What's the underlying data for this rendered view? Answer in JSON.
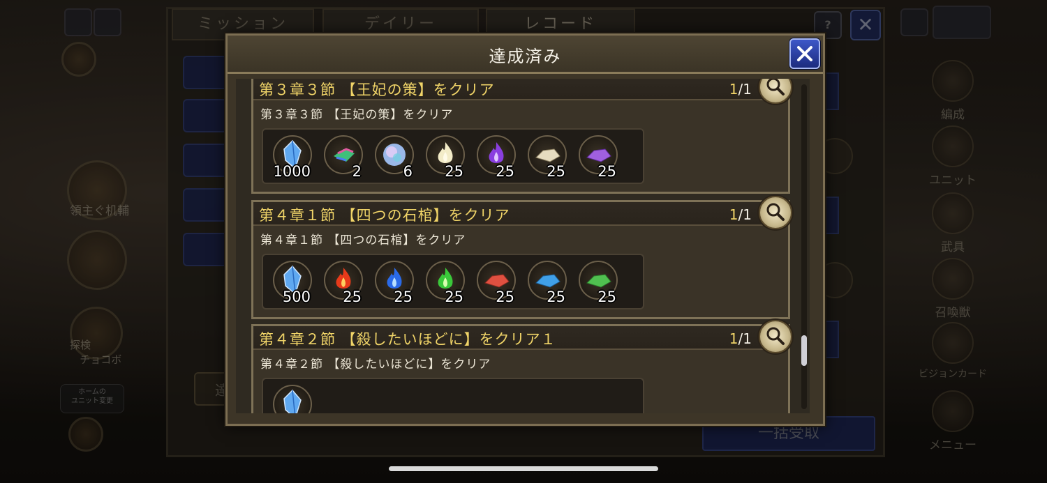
{
  "background": {
    "mission_tabs": [
      "ミッション",
      "デイリー",
      "レコード"
    ],
    "left_labels": [
      "領主ぐ机輔",
      "探検\nチョコボ"
    ],
    "home_bubble": "ホームの\nユニット変更",
    "right_menu": [
      "編成",
      "ユニット",
      "武具",
      "召喚獣",
      "ビジョンカード",
      "メニュー"
    ],
    "bulk_receive_label": "一括受取",
    "help_icon": "question-icon",
    "partial_left_button": "達"
  },
  "modal": {
    "title": "達成済み",
    "close_icon": "close-icon",
    "records": [
      {
        "title": "第３章３節 【王妃の策】をクリア",
        "progress_current": "1",
        "progress_sep": "/",
        "progress_total": "1",
        "description": "第３章３節 【王妃の策】をクリア",
        "rewards": [
          {
            "icon": "blue-crystal-icon",
            "count": "1000"
          },
          {
            "icon": "rainbow-prism-icon",
            "count": "2"
          },
          {
            "icon": "rainbow-orb-icon",
            "count": "6"
          },
          {
            "icon": "white-flame-icon",
            "count": "25"
          },
          {
            "icon": "purple-flame-icon",
            "count": "25"
          },
          {
            "icon": "white-ore-icon",
            "count": "25"
          },
          {
            "icon": "purple-ore-icon",
            "count": "25"
          }
        ]
      },
      {
        "title": "第４章１節 【四つの石棺】をクリア",
        "progress_current": "1",
        "progress_sep": "/",
        "progress_total": "1",
        "description": "第４章１節 【四つの石棺】をクリア",
        "rewards": [
          {
            "icon": "blue-crystal-icon",
            "count": "500"
          },
          {
            "icon": "red-flame-icon",
            "count": "25"
          },
          {
            "icon": "blue-flame-icon",
            "count": "25"
          },
          {
            "icon": "green-flame-icon",
            "count": "25"
          },
          {
            "icon": "red-ore-icon",
            "count": "25"
          },
          {
            "icon": "blue-ore-icon",
            "count": "25"
          },
          {
            "icon": "green-ore-icon",
            "count": "25"
          }
        ]
      },
      {
        "title": "第４章２節 【殺したいほどに】をクリア１",
        "progress_current": "1",
        "progress_sep": "/",
        "progress_total": "1",
        "description": "第４章２節 【殺したいほどに】をクリア",
        "rewards": [
          {
            "icon": "blue-crystal-icon",
            "count": ""
          }
        ]
      }
    ]
  },
  "colors": {
    "title_gold": "#f0d468",
    "accent_blue": "#2a3fa8"
  }
}
